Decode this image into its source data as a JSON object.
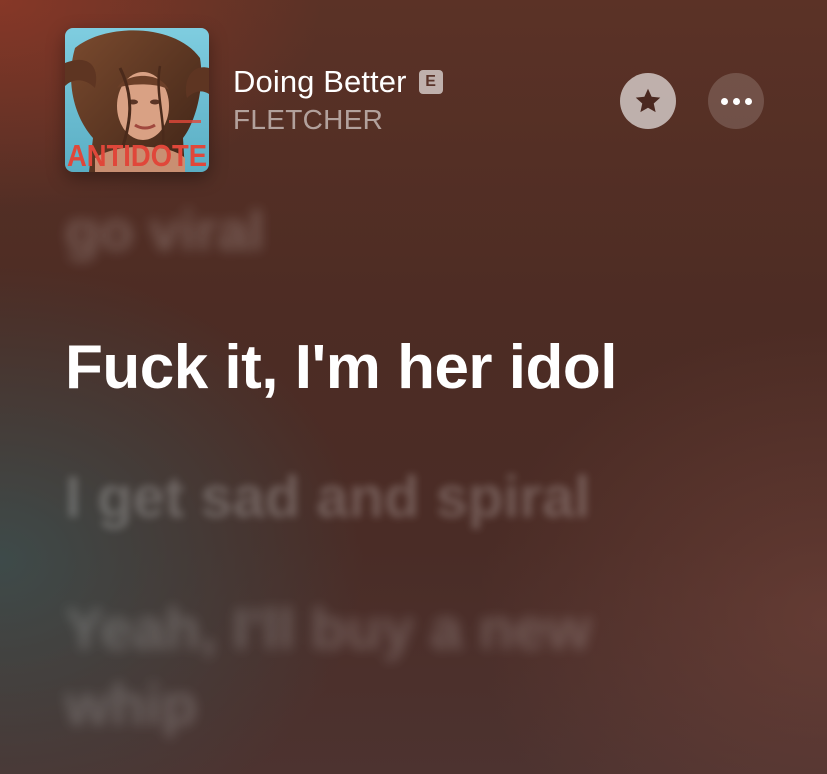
{
  "now_playing": {
    "album_cover_text": "ANTIDOTE",
    "title": "Doing Better",
    "explicit_badge": "E",
    "artist": "FLETCHER"
  },
  "actions": {
    "favorite_icon": "star-icon",
    "more_icon": "ellipsis-icon"
  },
  "lyrics": {
    "previous": "go viral",
    "current": "Fuck it, I'm her idol",
    "next": "I get sad and spiral",
    "after_next": "Yeah, I'll buy a new whip"
  },
  "colors": {
    "background": "#4d2c24",
    "album_text_red": "#e0473a",
    "album_sky": "#6fc0d4"
  }
}
